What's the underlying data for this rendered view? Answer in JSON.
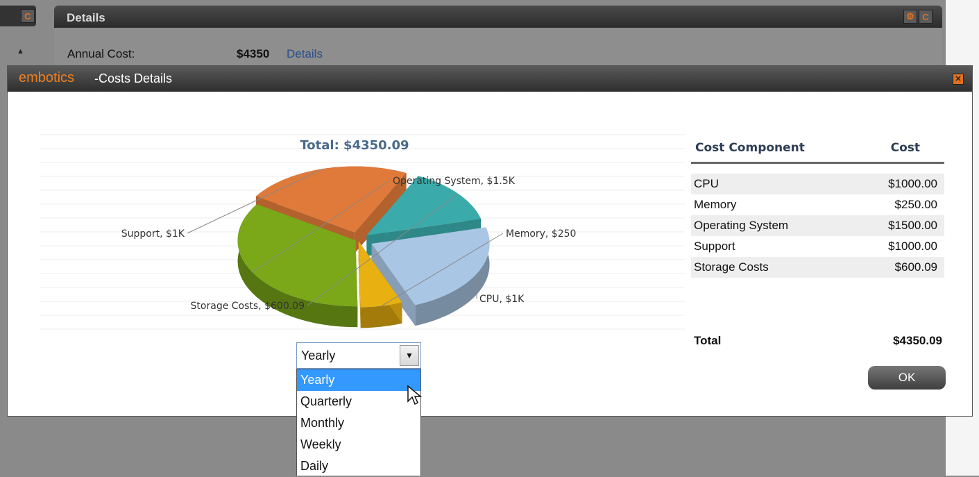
{
  "background": {
    "panel_title": "Details",
    "annual_cost_label": "Annual Cost:",
    "annual_cost_value": "$4350",
    "annual_cost_link": "Details"
  },
  "dialog": {
    "brand": "embotics",
    "title": "-Costs Details",
    "close_icon": "close-icon"
  },
  "chart_data": {
    "type": "pie",
    "title": "Total: $4350.09",
    "labels": [
      "CPU",
      "Memory",
      "Operating System",
      "Support",
      "Storage Costs"
    ],
    "values": [
      1000.0,
      250.0,
      1500.0,
      1000.0,
      600.09
    ],
    "slice_labels": [
      "CPU, $1K",
      "Memory, $250",
      "Operating System, $1.5K",
      "Support, $1K",
      "Storage Costs, $600.09"
    ],
    "colors": [
      "#a9c6e4",
      "#e8b010",
      "#7aa818",
      "#e07a3a",
      "#3aaaaa"
    ]
  },
  "table": {
    "header_component": "Cost Component",
    "header_cost": "Cost",
    "rows": [
      {
        "component": "CPU",
        "cost": "$1000.00"
      },
      {
        "component": "Memory",
        "cost": "$250.00"
      },
      {
        "component": "Operating System",
        "cost": "$1500.00"
      },
      {
        "component": "Support",
        "cost": "$1000.00"
      },
      {
        "component": "Storage Costs",
        "cost": "$600.09"
      }
    ],
    "total_label": "Total",
    "total_value": "$4350.09"
  },
  "ok_label": "OK",
  "period_select": {
    "selected": "Yearly",
    "options": [
      "Yearly",
      "Quarterly",
      "Monthly",
      "Weekly",
      "Daily"
    ],
    "highlighted": "Yearly"
  }
}
